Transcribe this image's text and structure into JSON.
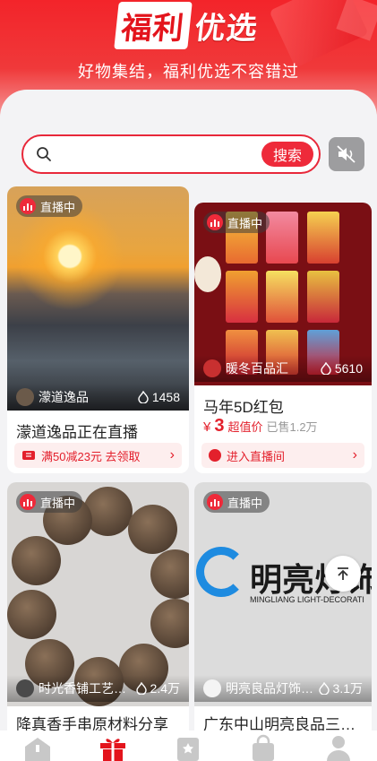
{
  "header": {
    "title_part1": "福利",
    "title_part2": "优选",
    "subtitle": "好物集结，福利优选不容错过"
  },
  "search": {
    "placeholder": "",
    "button_label": "搜索"
  },
  "cards": [
    {
      "live_label": "直播中",
      "shop_name": "濛道逸品",
      "heat": "1458",
      "title": "濛道逸品正在直播",
      "coupon_text": "满50减23元 去领取"
    },
    {
      "live_label": "直播中",
      "shop_name": "暖冬百品汇",
      "heat": "5610",
      "title": "马年5D红包",
      "price_currency": "¥",
      "price_value": "3",
      "price_tag": "超值价",
      "sold": "已售1.2万",
      "action_text": "进入直播间"
    },
    {
      "live_label": "直播中",
      "shop_name": "时光香铺工艺…",
      "heat": "2.4万",
      "title": "降真香手串原材料分享"
    },
    {
      "live_label": "直播中",
      "shop_name": "明亮良品灯饰旗…",
      "heat": "3.1万",
      "title": "广东中山明亮良品三室…",
      "logo_text": "明亮灯饰",
      "logo_subtext": "MINGLIANG LIGHT-DECORATI"
    }
  ],
  "tabbar": {
    "items": [
      "home-icon",
      "gift-icon",
      "star-icon",
      "bag-icon",
      "user-icon"
    ],
    "active": 1
  },
  "colors": {
    "accent": "#ee2a3a",
    "brand_red": "#e3141c"
  }
}
